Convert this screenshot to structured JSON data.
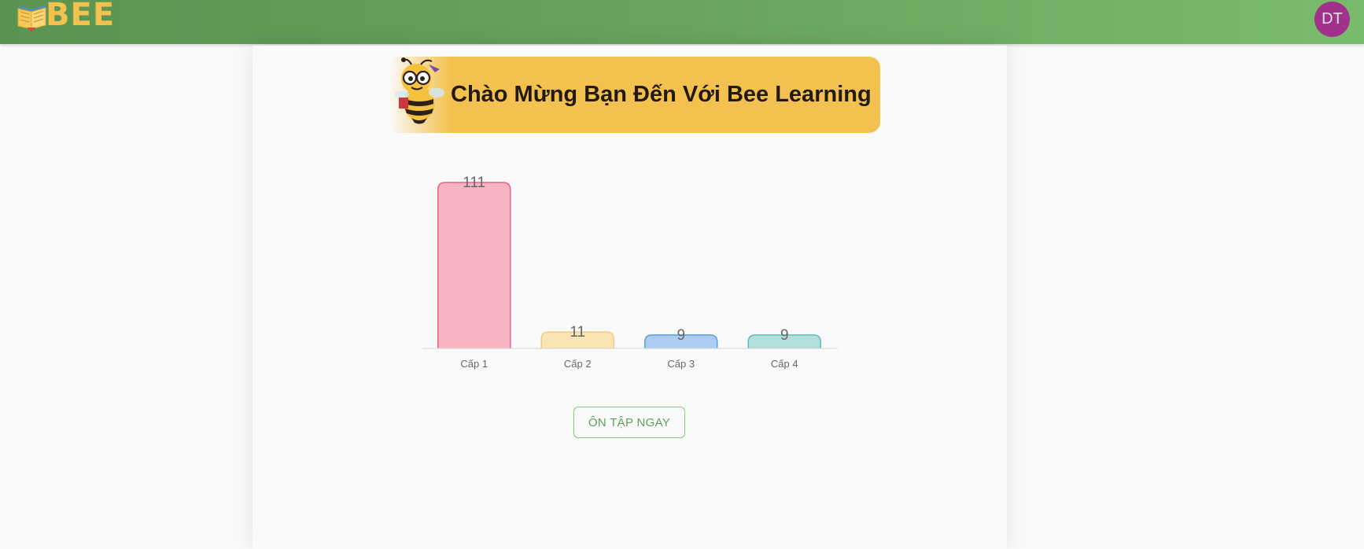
{
  "header": {
    "logo_text": "BEE",
    "avatar_initials": "DT",
    "accent_color": "#68a45d",
    "avatar_color": "#a1318b"
  },
  "banner": {
    "title": "Chào Mừng Bạn Đến Với Bee Learning",
    "mascot_icon": "bee-mascot-icon",
    "background_color": "#f3c150"
  },
  "chart_data": {
    "type": "bar",
    "categories": [
      "Cấp 1",
      "Cấp 2",
      "Cấp 3",
      "Cấp 4"
    ],
    "values": [
      111,
      11,
      9,
      9
    ],
    "title": "",
    "xlabel": "",
    "ylabel": "",
    "ylim": [
      0,
      111
    ],
    "grid": false,
    "legend": "none",
    "colors": [
      {
        "fill": "#f7b5c3",
        "stroke": "#e8637f"
      },
      {
        "fill": "#fbe4b3",
        "stroke": "#f2cb78"
      },
      {
        "fill": "#aacdf1",
        "stroke": "#5a9ee0"
      },
      {
        "fill": "#b3dfdd",
        "stroke": "#62bcb8"
      }
    ]
  },
  "actions": {
    "review_label": "ÔN TẬP NGAY"
  }
}
